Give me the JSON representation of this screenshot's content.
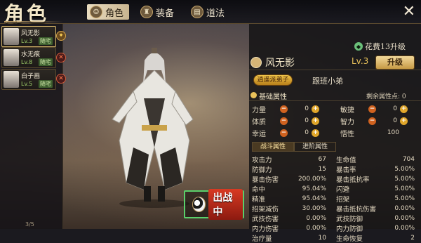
{
  "header": {
    "title": "角色",
    "tabs": [
      {
        "label": "角色",
        "icon": "person-icon",
        "active": true
      },
      {
        "label": "装备",
        "icon": "armor-icon",
        "active": false
      },
      {
        "label": "道法",
        "icon": "book-icon",
        "active": false
      }
    ],
    "close_label": "✕"
  },
  "roster": {
    "items": [
      {
        "name": "风无影",
        "level": "Lv.3",
        "tag": "随宅",
        "selected": true,
        "action": "bag-icon"
      },
      {
        "name": "水无痕",
        "level": "Lv.8",
        "tag": "随宅",
        "selected": false,
        "action": "remove-icon"
      },
      {
        "name": "白子画",
        "level": "Lv.5",
        "tag": "随宅",
        "selected": false,
        "action": "remove-icon"
      }
    ],
    "count": "3/5"
  },
  "deploy": {
    "label": "出战中"
  },
  "panel": {
    "rank": "花费13升级",
    "name": "风无影",
    "level": "Lv.3",
    "upgrade_label": "升级",
    "sect_badge": "逍遥派弟子",
    "role": "跟班小弟",
    "basic_section": "基础属性",
    "remaining_points_label": "剩余属性点: 0",
    "attrs_left": [
      {
        "label": "力量",
        "value": "0"
      },
      {
        "label": "体质",
        "value": "0"
      },
      {
        "label": "幸运",
        "value": "0"
      }
    ],
    "attrs_right": [
      {
        "label": "敏捷",
        "value": "0"
      },
      {
        "label": "智力",
        "value": "0"
      },
      {
        "label": "悟性",
        "value": "100"
      }
    ],
    "subtabs": [
      {
        "label": "战斗属性",
        "active": true
      },
      {
        "label": "进阶属性",
        "active": false
      }
    ],
    "stats": [
      {
        "k": "攻击力",
        "v": "67",
        "k2": "生命值",
        "v2": "704"
      },
      {
        "k": "防御力",
        "v": "15",
        "k2": "暴击率",
        "v2": "5.00%"
      },
      {
        "k": "暴击伤害",
        "v": "200.00%",
        "k2": "暴击抵抗率",
        "v2": "5.00%"
      },
      {
        "k": "命中",
        "v": "95.04%",
        "k2": "闪避",
        "v2": "5.00%"
      },
      {
        "k": "精准",
        "v": "95.04%",
        "k2": "招架",
        "v2": "5.00%"
      },
      {
        "k": "招架减伤",
        "v": "30.00%",
        "k2": "暴击抵抗伤害",
        "v2": "0.00%"
      },
      {
        "k": "武技伤害",
        "v": "0.00%",
        "k2": "武技防御",
        "v2": "0.00%"
      },
      {
        "k": "内力伤害",
        "v": "0.00%",
        "k2": "内力防御",
        "v2": "0.00%"
      },
      {
        "k": "治疗量",
        "v": "10",
        "k2": "生命恢复",
        "v2": "2"
      }
    ]
  }
}
